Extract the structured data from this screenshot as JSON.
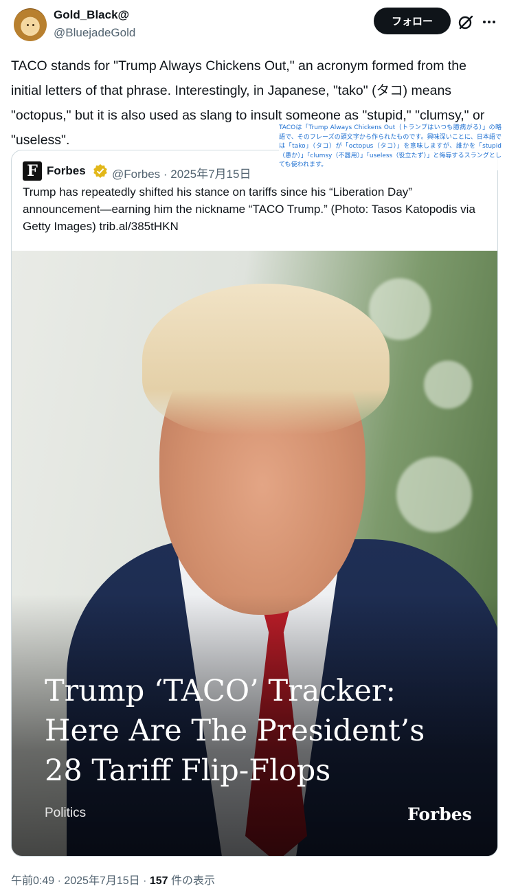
{
  "author": {
    "display_name": "Gold_Black@",
    "handle": "@BluejadeGold",
    "avatar_icon": "lion-avatar"
  },
  "header": {
    "follow_label": "フォロー",
    "grok_icon": "grok-icon",
    "more_icon": "more-icon"
  },
  "tweet": {
    "text": "TACO stands for \"Trump Always Chickens Out,\" an acronym formed from the initial letters of that phrase. Interestingly, in Japanese, \"tako\" (タコ) means \"octopus,\" but it is also used as slang to insult someone as \"stupid,\" \"clumsy,\" or \"useless\".",
    "translation_overlay": "TACOは「Trump Always Chickens Out（トランプはいつも臆病がる）」の略語で、そのフレーズの頭文字から作られたものです。興味深いことに、日本語では「tako」（タコ）が「octopus（タコ）」を意味しますが、誰かを「stupid（愚か）」「clumsy（不器用）」「useless（役立たず）」と侮辱するスラングとしても使われます。"
  },
  "quote": {
    "logo_letter": "F",
    "name": "Forbes",
    "verified_color": "#e2b719",
    "meta": "@Forbes · 2025年7月15日",
    "text": "Trump has repeatedly shifted his stance on tariffs since his “Liberation Day” announcement—earning him the nickname “TACO Trump.” (Photo: Tasos Katopodis via Getty Images) trib.al/385tHKN",
    "card": {
      "headline_lines": [
        "Trump ‘TACO’ Tracker:",
        "Here Are The President’s",
        "28 Tariff Flip-Flops"
      ],
      "category": "Politics",
      "brand": "Forbes"
    }
  },
  "footer": {
    "time": "午前0:49 · 2025年7月15日 · ",
    "views_count": "157",
    "views_label": " 件の表示"
  },
  "colors": {
    "text": "#0f1419",
    "muted": "#536471",
    "border": "#cfd9de",
    "translation": "#1d6fd1"
  }
}
